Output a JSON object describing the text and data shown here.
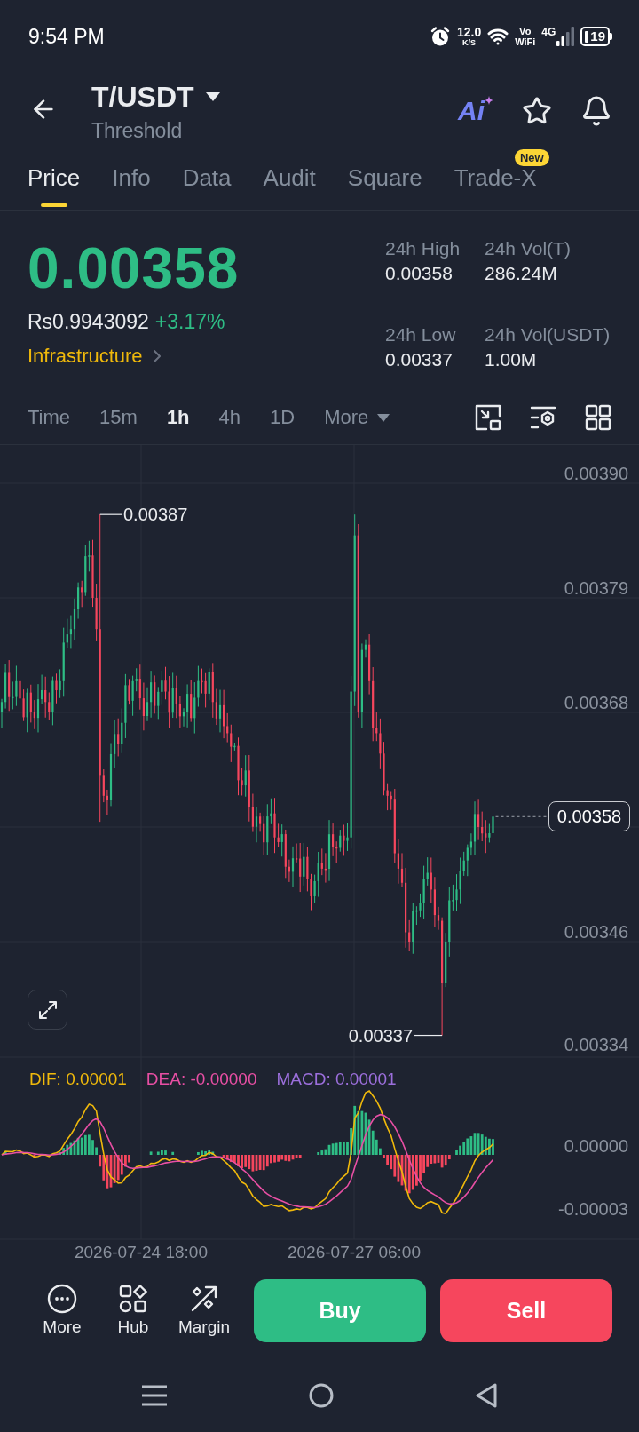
{
  "status_bar": {
    "time": "9:54 PM",
    "net_speed": "12.0",
    "net_unit": "K/S",
    "call_mode": "Vo",
    "call_mode_sub": "WiFi",
    "network": "4G",
    "battery": "19"
  },
  "header": {
    "pair": "T/USDT",
    "name": "Threshold",
    "ai_label": "Ai"
  },
  "tabs": [
    {
      "label": "Price",
      "selected": true
    },
    {
      "label": "Info",
      "selected": false
    },
    {
      "label": "Data",
      "selected": false
    },
    {
      "label": "Audit",
      "selected": false
    },
    {
      "label": "Square",
      "selected": false
    },
    {
      "label": "Trade-X",
      "selected": false,
      "badge": "New"
    }
  ],
  "price": {
    "last": "0.00358",
    "fiat": "Rs0.9943092",
    "change": "+3.17%",
    "sector": "Infrastructure"
  },
  "stats": [
    {
      "label": "24h High",
      "value": "0.00358"
    },
    {
      "label": "24h Vol(T)",
      "value": "286.24M"
    },
    {
      "label": "24h Low",
      "value": "0.00337"
    },
    {
      "label": "24h Vol(USDT)",
      "value": "1.00M"
    }
  ],
  "intervals": [
    {
      "label": "Time",
      "selected": false,
      "kind": "option"
    },
    {
      "label": "15m",
      "selected": false,
      "kind": "option"
    },
    {
      "label": "1h",
      "selected": true,
      "kind": "option"
    },
    {
      "label": "4h",
      "selected": false,
      "kind": "option"
    },
    {
      "label": "1D",
      "selected": false,
      "kind": "option"
    },
    {
      "label": "More",
      "selected": false,
      "kind": "dropdown"
    }
  ],
  "price_chart": {
    "axis_labels": [
      "0.00390",
      "0.00379",
      "0.00368",
      "0.00346",
      "0.00334"
    ],
    "high_label": "0.00387",
    "low_label": "0.00337",
    "last_price": "0.00358"
  },
  "macd": {
    "legend": [
      {
        "label": "DIF: 0.00001",
        "color": "#f0b90b"
      },
      {
        "label": "DEA: -0.00000",
        "color": "#e84fa4"
      },
      {
        "label": "MACD: 0.00001",
        "color": "#9c6fdc"
      }
    ],
    "axis_labels": [
      "0.00000",
      "-0.00003"
    ]
  },
  "time_axis": [
    "2026-07-24 18:00",
    "2026-07-27 06:00"
  ],
  "actions": [
    {
      "label": "More"
    },
    {
      "label": "Hub"
    },
    {
      "label": "Margin"
    }
  ],
  "trade_buttons": [
    {
      "label": "Buy",
      "kind": "buy"
    },
    {
      "label": "Sell",
      "kind": "sell"
    }
  ]
}
